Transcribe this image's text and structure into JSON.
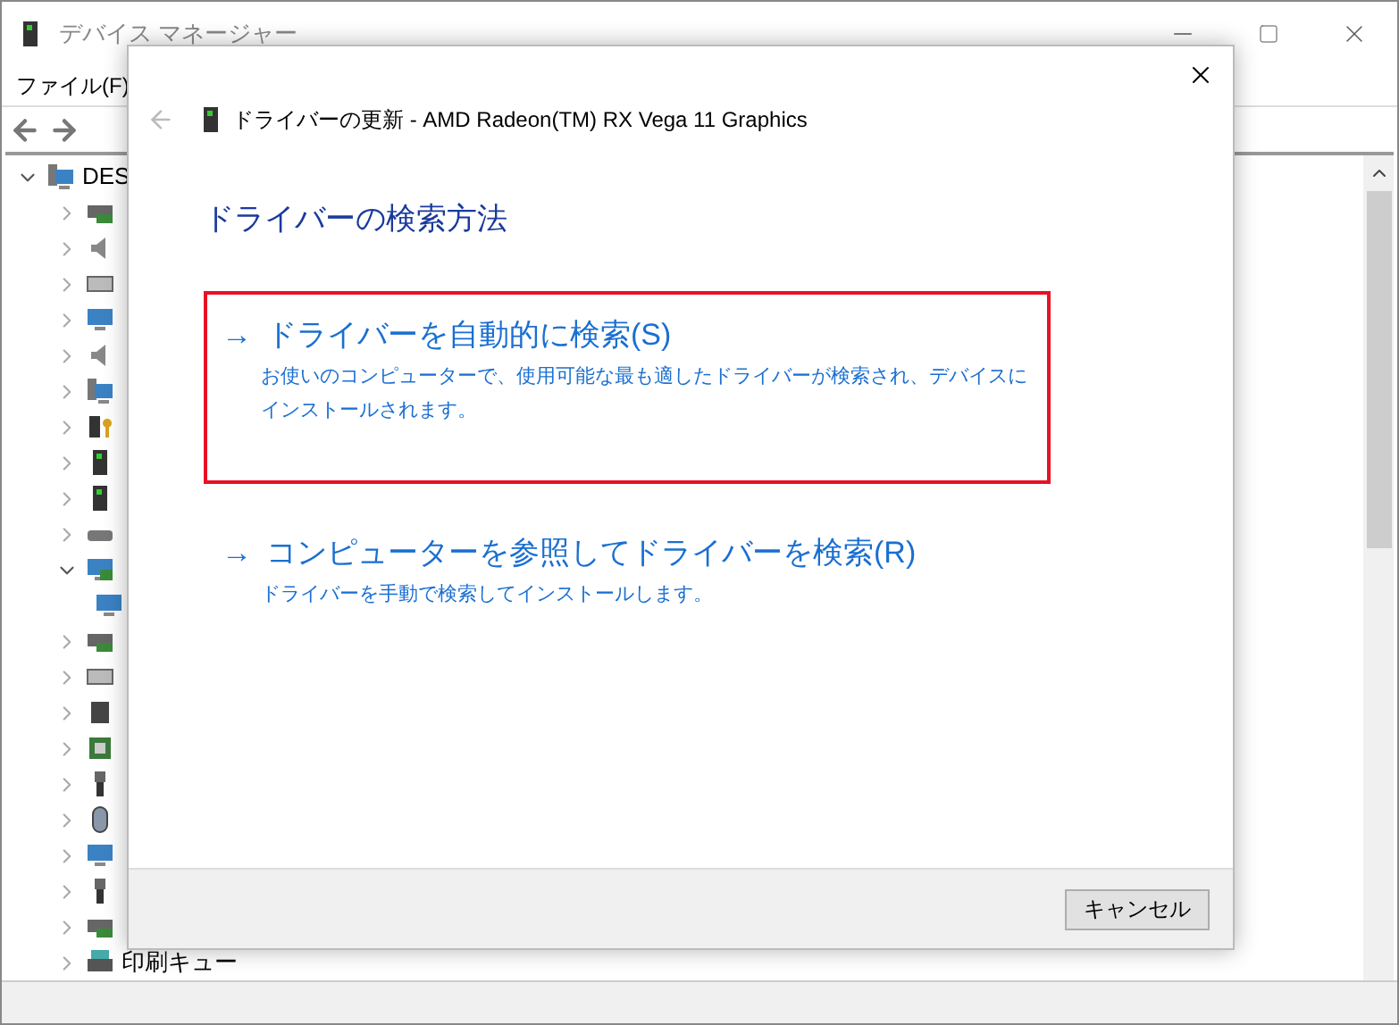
{
  "window": {
    "title": "デバイス マネージャー"
  },
  "menu": [
    "ファイル(F)"
  ],
  "tree": {
    "label": "DES",
    "expanded": true,
    "children": [
      {
        "kind": "network",
        "expanded": false
      },
      {
        "kind": "audio",
        "expanded": false
      },
      {
        "kind": "keyboard",
        "expanded": false
      },
      {
        "kind": "monitor",
        "expanded": false
      },
      {
        "kind": "audio",
        "expanded": false
      },
      {
        "kind": "computer",
        "expanded": false
      },
      {
        "kind": "security",
        "expanded": false
      },
      {
        "kind": "device",
        "expanded": false
      },
      {
        "kind": "device",
        "expanded": false
      },
      {
        "kind": "drive",
        "expanded": false
      },
      {
        "kind": "display",
        "expanded": true,
        "children": [
          {
            "kind": "monitor"
          }
        ]
      },
      {
        "kind": "network",
        "expanded": false
      },
      {
        "kind": "keyboard",
        "expanded": false
      },
      {
        "kind": "chip",
        "expanded": false
      },
      {
        "kind": "processor",
        "expanded": false
      },
      {
        "kind": "usb",
        "expanded": false
      },
      {
        "kind": "mouse",
        "expanded": false
      },
      {
        "kind": "monitor",
        "expanded": false
      },
      {
        "kind": "usb",
        "expanded": false
      },
      {
        "kind": "network",
        "expanded": false
      },
      {
        "kind": "printer",
        "label": "印刷キュー",
        "expanded": false
      }
    ]
  },
  "dialog": {
    "title": "ドライバーの更新 - AMD Radeon(TM) RX Vega 11 Graphics",
    "heading": "ドライバーの検索方法",
    "options": [
      {
        "arrow": "→",
        "title": "ドライバーを自動的に検索(S)",
        "description": "お使いのコンピューターで、使用可能な最も適したドライバーが検索され、デバイスにインストールされます。",
        "selected": true
      },
      {
        "arrow": "→",
        "title": "コンピューターを参照してドライバーを検索(R)",
        "description": "ドライバーを手動で検索してインストールします。",
        "selected": false
      }
    ],
    "buttons": [
      "キャンセル"
    ]
  }
}
